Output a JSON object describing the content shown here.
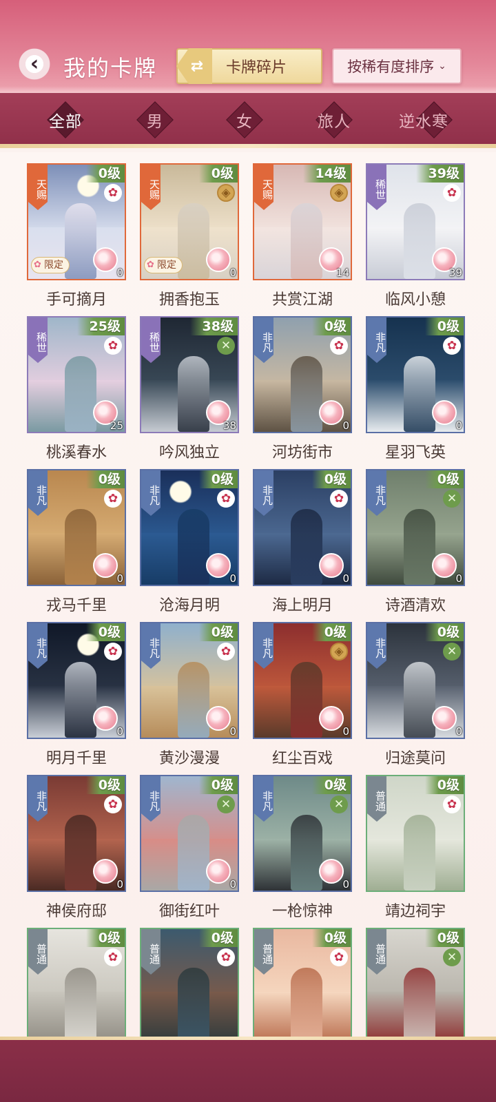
{
  "header": {
    "title": "我的卡牌",
    "fragments_label": "卡牌碎片",
    "sort_label": "按稀有度排序"
  },
  "tabs": [
    {
      "label": "全部",
      "active": true
    },
    {
      "label": "男",
      "active": false
    },
    {
      "label": "女",
      "active": false
    },
    {
      "label": "旅人",
      "active": false
    },
    {
      "label": "逆水寒",
      "active": false
    }
  ],
  "colors": {
    "header_pink": "#d65f7a",
    "filter_bar": "#9a3752",
    "rarity_tianci": "#e0683a",
    "rarity_xishi": "#8a72b8",
    "rarity_feifan": "#5d78ad",
    "rarity_putong": "#7b8790",
    "level_green": "#6e9c4c"
  },
  "cards": [
    {
      "name": "手可摘月",
      "level": "0级",
      "rarity": "天赐",
      "rclass": "r-tianci",
      "emblem": "plum-icon",
      "fragments": "0",
      "limited": "限定"
    },
    {
      "name": "拥香抱玉",
      "level": "0级",
      "rarity": "天赐",
      "rclass": "r-tianci",
      "emblem": "coin-icon",
      "fragments": "0",
      "limited": "限定"
    },
    {
      "name": "共赏江湖",
      "level": "14级",
      "rarity": "天赐",
      "rclass": "r-tianci",
      "emblem": "coin-icon",
      "fragments": "14",
      "limited": ""
    },
    {
      "name": "临风小憩",
      "level": "39级",
      "rarity": "稀世",
      "rclass": "r-xishi",
      "emblem": "plum-icon",
      "fragments": "39",
      "limited": ""
    },
    {
      "name": "桃溪春水",
      "level": "25级",
      "rarity": "稀世",
      "rclass": "r-xishi",
      "emblem": "plum-icon",
      "fragments": "25",
      "limited": ""
    },
    {
      "name": "吟风独立",
      "level": "38级",
      "rarity": "稀世",
      "rclass": "r-xishi",
      "emblem": "sword-icon",
      "fragments": "38",
      "limited": ""
    },
    {
      "name": "河坊街市",
      "level": "0级",
      "rarity": "非凡",
      "rclass": "r-feifan",
      "emblem": "plum-icon",
      "fragments": "0",
      "limited": ""
    },
    {
      "name": "星羽飞英",
      "level": "0级",
      "rarity": "非凡",
      "rclass": "r-feifan",
      "emblem": "plum-icon",
      "fragments": "0",
      "limited": ""
    },
    {
      "name": "戎马千里",
      "level": "0级",
      "rarity": "非凡",
      "rclass": "r-feifan",
      "emblem": "plum-icon",
      "fragments": "0",
      "limited": ""
    },
    {
      "name": "沧海月明",
      "level": "0级",
      "rarity": "非凡",
      "rclass": "r-feifan",
      "emblem": "plum-icon",
      "fragments": "0",
      "limited": ""
    },
    {
      "name": "海上明月",
      "level": "0级",
      "rarity": "非凡",
      "rclass": "r-feifan",
      "emblem": "plum-icon",
      "fragments": "0",
      "limited": ""
    },
    {
      "name": "诗酒清欢",
      "level": "0级",
      "rarity": "非凡",
      "rclass": "r-feifan",
      "emblem": "sword-icon",
      "fragments": "0",
      "limited": ""
    },
    {
      "name": "明月千里",
      "level": "0级",
      "rarity": "非凡",
      "rclass": "r-feifan",
      "emblem": "plum-icon",
      "fragments": "0",
      "limited": ""
    },
    {
      "name": "黄沙漫漫",
      "level": "0级",
      "rarity": "非凡",
      "rclass": "r-feifan",
      "emblem": "plum-icon",
      "fragments": "0",
      "limited": ""
    },
    {
      "name": "红尘百戏",
      "level": "0级",
      "rarity": "非凡",
      "rclass": "r-feifan",
      "emblem": "coin-icon",
      "fragments": "0",
      "limited": ""
    },
    {
      "name": "归途莫问",
      "level": "0级",
      "rarity": "非凡",
      "rclass": "r-feifan",
      "emblem": "sword-icon",
      "fragments": "0",
      "limited": ""
    },
    {
      "name": "神侯府邸",
      "level": "0级",
      "rarity": "非凡",
      "rclass": "r-feifan",
      "emblem": "plum-icon",
      "fragments": "0",
      "limited": ""
    },
    {
      "name": "御街红叶",
      "level": "0级",
      "rarity": "非凡",
      "rclass": "r-feifan",
      "emblem": "sword-icon",
      "fragments": "0",
      "limited": ""
    },
    {
      "name": "一枪惊神",
      "level": "0级",
      "rarity": "非凡",
      "rclass": "r-feifan",
      "emblem": "sword-icon",
      "fragments": "0",
      "limited": ""
    },
    {
      "name": "靖边祠宇",
      "level": "0级",
      "rarity": "普通",
      "rclass": "r-putong",
      "emblem": "plum-icon",
      "fragments": "",
      "limited": ""
    },
    {
      "name": "",
      "level": "0级",
      "rarity": "普通",
      "rclass": "r-putong",
      "emblem": "plum-icon",
      "fragments": "",
      "limited": ""
    },
    {
      "name": "",
      "level": "0级",
      "rarity": "普通",
      "rclass": "r-putong",
      "emblem": "plum-icon",
      "fragments": "",
      "limited": ""
    },
    {
      "name": "",
      "level": "0级",
      "rarity": "普通",
      "rclass": "r-putong",
      "emblem": "plum-icon",
      "fragments": "",
      "limited": ""
    },
    {
      "name": "",
      "level": "0级",
      "rarity": "普通",
      "rclass": "r-putong",
      "emblem": "sword-icon",
      "fragments": "",
      "limited": ""
    }
  ]
}
